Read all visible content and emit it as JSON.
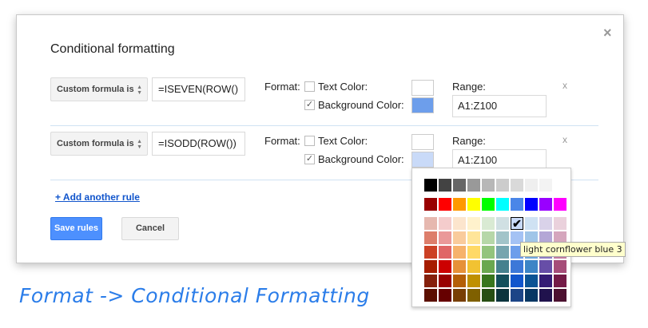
{
  "dialog": {
    "title": "Conditional formatting",
    "close": "×",
    "rules": [
      {
        "condition": "Custom formula is",
        "formula": "=ISEVEN(ROW()",
        "format_label": "Format:",
        "text_color_label": "Text Color:",
        "text_color_checked": false,
        "text_color": "#ffffff",
        "bg_label": "Background Color:",
        "bg_checked": true,
        "bg_color": "#6d9eeb",
        "range_label": "Range:",
        "range": "A1:Z100",
        "remove": "x"
      },
      {
        "condition": "Custom formula is",
        "formula": "=ISODD(ROW())",
        "format_label": "Format:",
        "text_color_label": "Text Color:",
        "text_color_checked": false,
        "text_color": "#ffffff",
        "bg_label": "Background Color:",
        "bg_checked": true,
        "bg_color": "#c9daf8",
        "range_label": "Range:",
        "range": "A1:Z100",
        "remove": "x"
      }
    ],
    "add_rule": "+ Add another rule",
    "save": "Save rules",
    "cancel": "Cancel"
  },
  "palette": {
    "selected": "light cornflower blue 3",
    "tooltip": "light cornflower blue 3",
    "rows": [
      [
        "#000000",
        "#434343",
        "#666666",
        "#999999",
        "#b7b7b7",
        "#cccccc",
        "#d9d9d9",
        "#efefef",
        "#f3f3f3",
        "#ffffff"
      ],
      [
        "#980000",
        "#ff0000",
        "#ff9900",
        "#ffff00",
        "#00ff00",
        "#00ffff",
        "#4a86e8",
        "#0000ff",
        "#9900ff",
        "#ff00ff"
      ],
      [
        "#e6b8af",
        "#f4cccc",
        "#fce5cd",
        "#fff2cc",
        "#d9ead3",
        "#d0e0e3",
        "#c9daf8",
        "#cfe2f3",
        "#d9d2e9",
        "#ead1dc"
      ],
      [
        "#dd7e6b",
        "#ea9999",
        "#f9cb9c",
        "#ffe599",
        "#b6d7a8",
        "#a2c4c9",
        "#a4c2f4",
        "#9fc5e8",
        "#b4a7d6",
        "#d5a6bd"
      ],
      [
        "#cc4125",
        "#e06666",
        "#f6b26b",
        "#ffd966",
        "#93c47d",
        "#76a5af",
        "#6d9eeb",
        "#6fa8dc",
        "#8e7cc3",
        "#c27ba0"
      ],
      [
        "#a61c00",
        "#cc0000",
        "#e69138",
        "#f1c232",
        "#6aa84f",
        "#45818e",
        "#3c78d8",
        "#3d85c6",
        "#674ea7",
        "#a64d79"
      ],
      [
        "#85200c",
        "#990000",
        "#b45f06",
        "#bf9000",
        "#38761d",
        "#134f5c",
        "#1155cc",
        "#0b5394",
        "#351c75",
        "#741b47"
      ],
      [
        "#5b0f00",
        "#660000",
        "#783f04",
        "#7f6000",
        "#274e13",
        "#0c343d",
        "#1c4587",
        "#073763",
        "#20124d",
        "#4c1130"
      ]
    ],
    "selected_row": 2,
    "selected_col": 6,
    "check": "✔"
  },
  "caption": "Format -> Conditional Formatting"
}
